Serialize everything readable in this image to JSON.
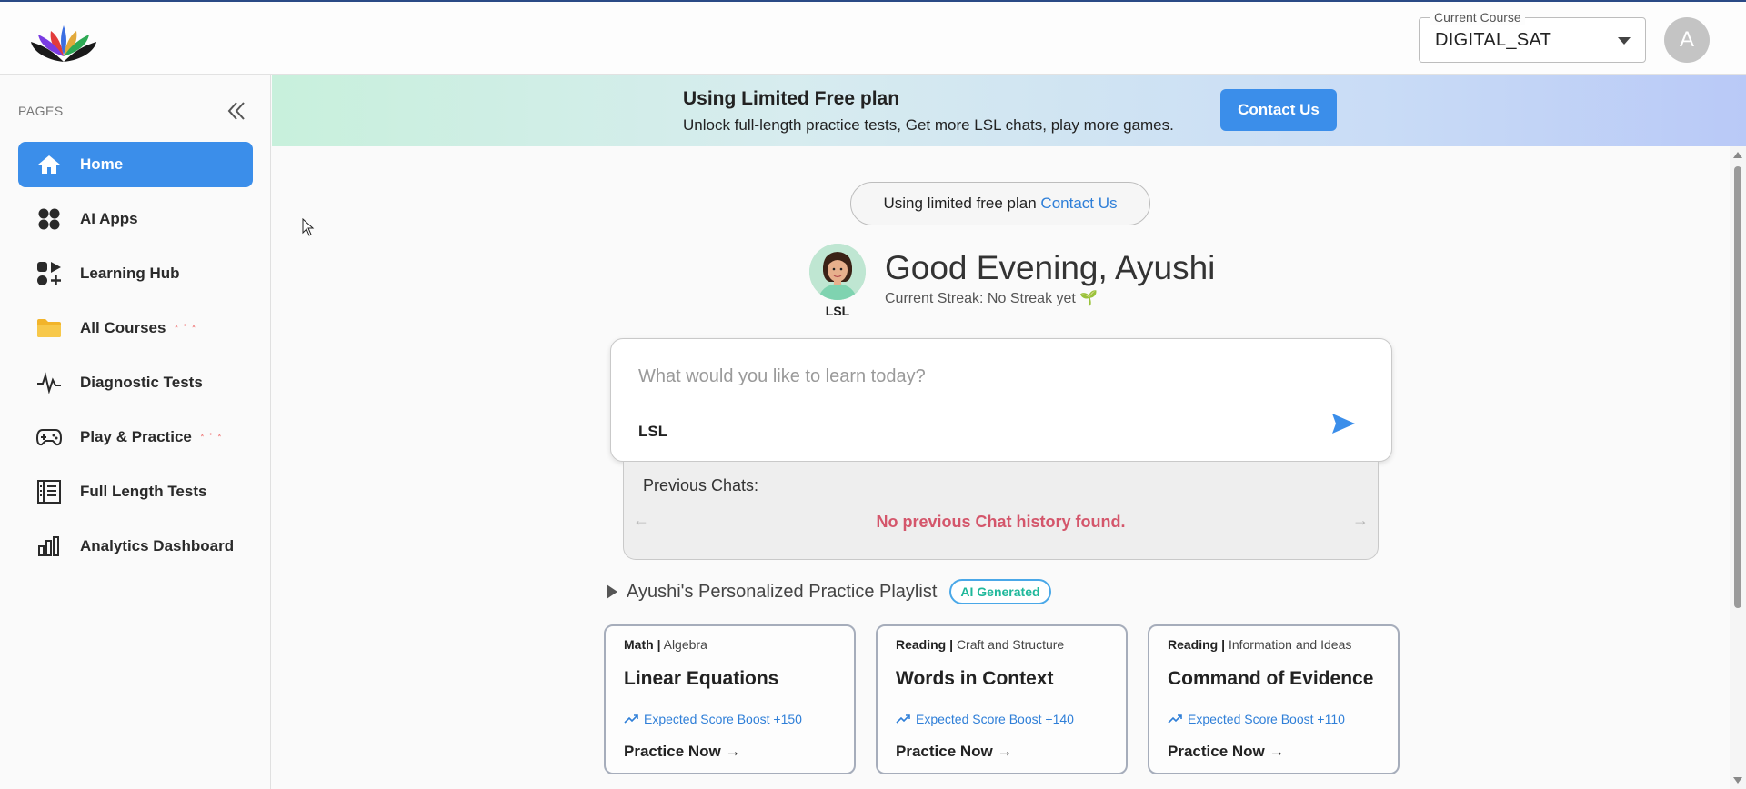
{
  "header": {
    "course_legend": "Current Course",
    "course_value": "DIGITAL_SAT",
    "avatar_letter": "A"
  },
  "sidebar": {
    "section_label": "PAGES",
    "items": [
      {
        "label": "Home",
        "icon": "home-icon",
        "active": true
      },
      {
        "label": "AI Apps",
        "icon": "apps-icon"
      },
      {
        "label": "Learning Hub",
        "icon": "learning-hub-icon"
      },
      {
        "label": "All Courses",
        "icon": "folder-icon",
        "sparkle": "˟ ˚ ˟"
      },
      {
        "label": "Diagnostic Tests",
        "icon": "pulse-icon"
      },
      {
        "label": "Play & Practice",
        "icon": "gamepad-icon",
        "sparkle": "˟ ˚ ˟"
      },
      {
        "label": "Full Length Tests",
        "icon": "document-list-icon"
      },
      {
        "label": "Analytics Dashboard",
        "icon": "bar-chart-icon"
      }
    ]
  },
  "banner": {
    "title": "Using Limited Free plan",
    "subtitle": "Unlock full-length practice tests, Get more LSL chats, play more games.",
    "button_label": "Contact Us"
  },
  "plan_pill": {
    "text": "Using limited free plan",
    "link": "Contact Us"
  },
  "greeting": {
    "avatar_caption": "LSL",
    "title": "Good Evening, Ayushi",
    "streak": "Current Streak: No Streak yet 🌱"
  },
  "chat": {
    "placeholder": "What would you like to learn today?",
    "chip": "LSL"
  },
  "previous_chats": {
    "title": "Previous Chats:",
    "empty_message": "No previous Chat history found."
  },
  "playlist": {
    "title": "Ayushi's Personalized Practice Playlist",
    "badge": "AI Generated",
    "cards": [
      {
        "subject": "Math",
        "topic": "Algebra",
        "title": "Linear Equations",
        "boost": "Expected Score Boost +150",
        "cta": "Practice Now"
      },
      {
        "subject": "Reading",
        "topic": "Craft and Structure",
        "title": "Words in Context",
        "boost": "Expected Score Boost +140",
        "cta": "Practice Now"
      },
      {
        "subject": "Reading",
        "topic": "Information and Ideas",
        "title": "Command of Evidence",
        "boost": "Expected Score Boost +110",
        "cta": "Practice Now"
      }
    ]
  },
  "colors": {
    "accent": "#3b8eea",
    "danger_text": "#d4566b",
    "link": "#2f7fd8"
  }
}
